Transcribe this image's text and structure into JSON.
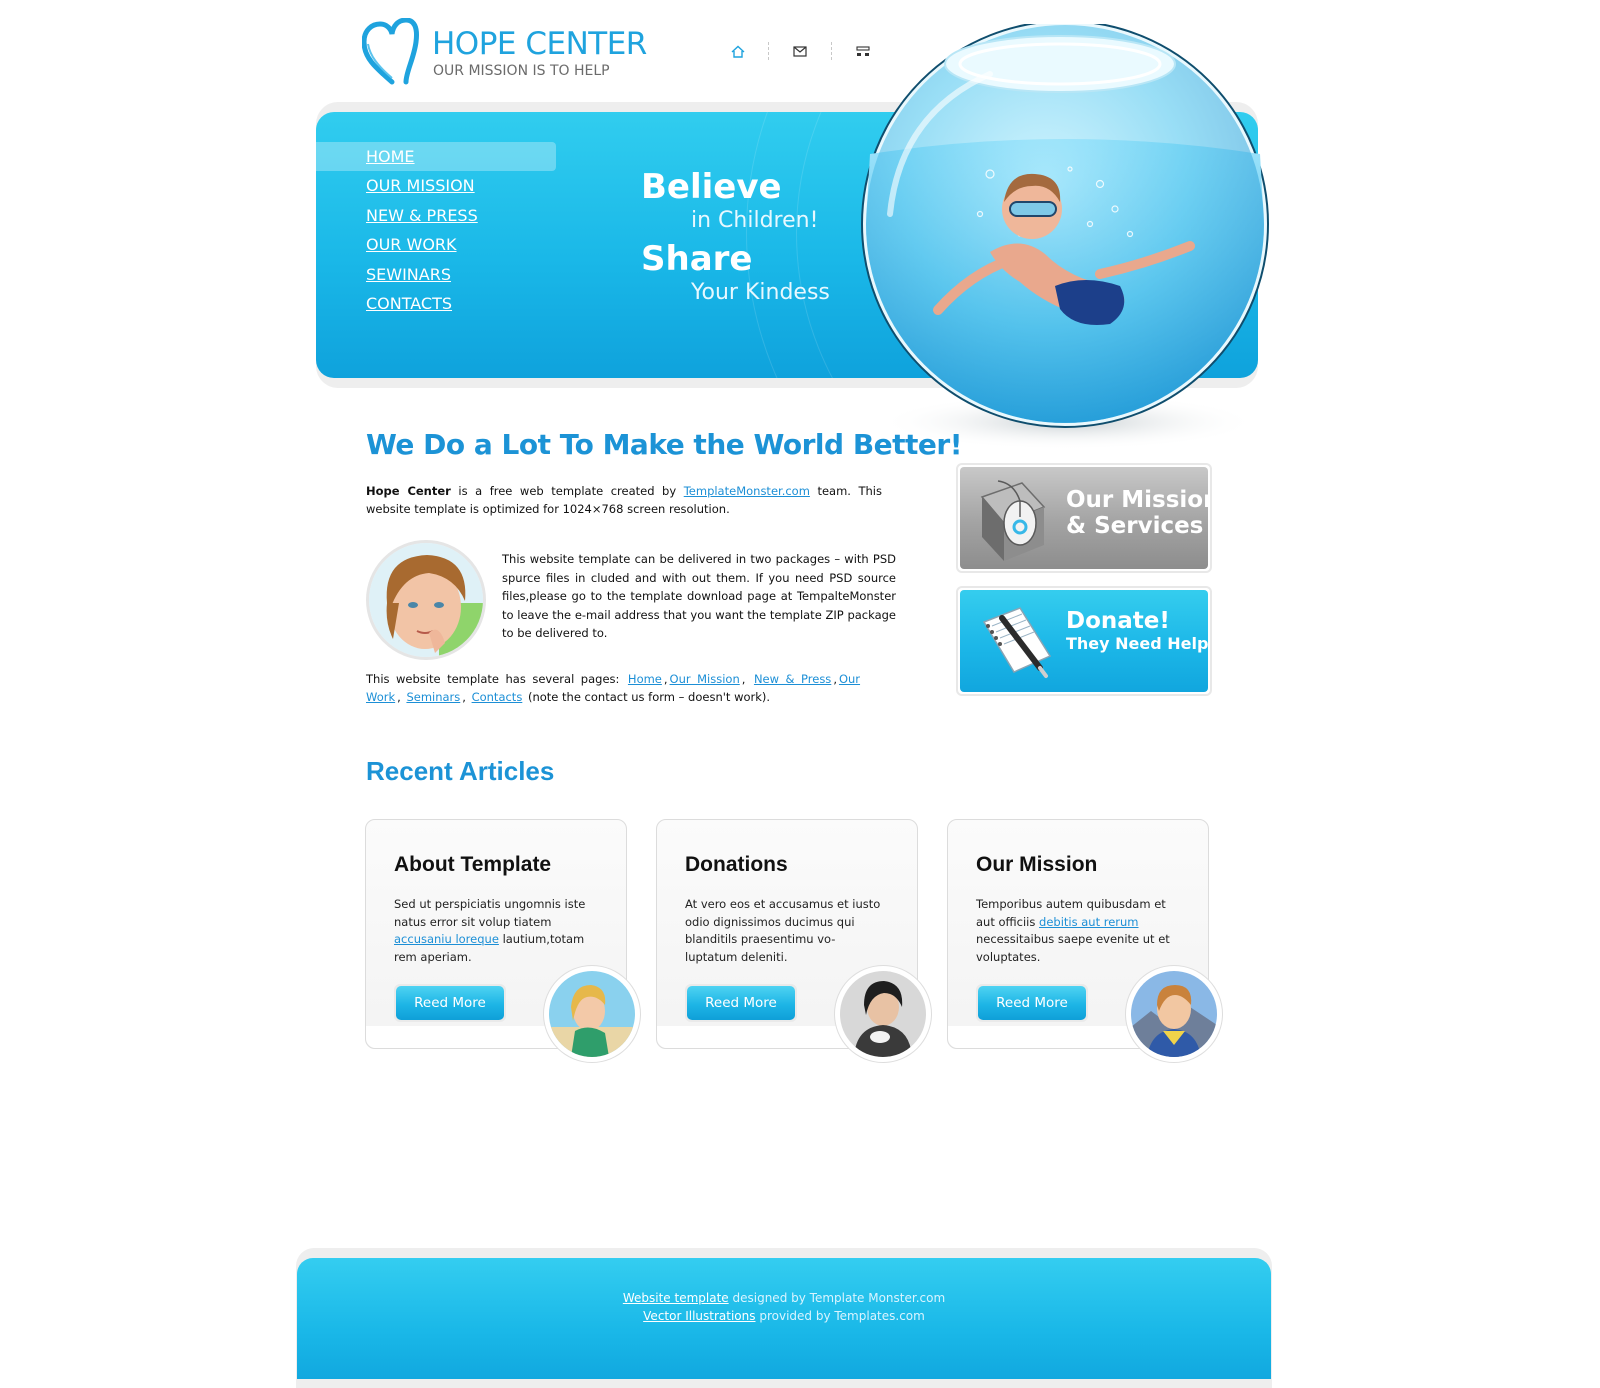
{
  "header": {
    "logo_title": "HOPE CENTER",
    "logo_subtitle": "OUR MISSION IS TO HELP",
    "icons": [
      "home-icon",
      "mail-icon",
      "sitemap-icon"
    ]
  },
  "nav": {
    "items": [
      {
        "label": "HOME",
        "active": true
      },
      {
        "label": "OUR MISSION",
        "active": false
      },
      {
        "label": "NEW & PRESS",
        "active": false
      },
      {
        "label": "OUR WORK",
        "active": false
      },
      {
        "label": "SEWINARS",
        "active": false
      },
      {
        "label": "CONTACTS",
        "active": false
      }
    ]
  },
  "banner": {
    "line1": "Believe",
    "line2": "in Children!",
    "line3": "Share",
    "line4": "Your Kindess"
  },
  "main": {
    "headline": "We Do a Lot To Make the World Better!",
    "intro_brand": "Hope Center",
    "intro_text1": "is a free web template created by",
    "intro_link": "TemplateMonster.com",
    "intro_text2": "team. This website template is optimized for 1024×768 screen resolution.",
    "para2": "This website template can be delivered in two packages – with PSD spurce files in cluded and with out them. If you need PSD source files,please go to the template download page at TempalteMonster to leave the e-mail address that you want the template ZIP package to be delivered to.",
    "pages_text": "This website template has several pages:",
    "pages_links": [
      "Home",
      "Our Mission",
      "New & Press",
      "Our Work",
      "Seminars",
      "Contacts"
    ],
    "pages_note": "(note the contact us form – doesn't work)."
  },
  "promos": {
    "missions": {
      "line1": "Our Missions",
      "line2": "& Services",
      "color": "#a3a3a3"
    },
    "donate": {
      "line1": "Donate!",
      "line2": "They Need Help",
      "color": "#1cb7e8"
    }
  },
  "recent": {
    "title": "Recent Articles",
    "button_label": "Reed More",
    "cards": [
      {
        "title": "About Template",
        "text1": "Sed ut perspiciatis ungomnis iste natus error sit volup tiatem",
        "link": "accusaniu loreque",
        "text2": "lautium,totam rem aperiam."
      },
      {
        "title": "Donations",
        "text1": "At vero eos et accusamus et iusto odio dignissimos ducimus qui blanditils praesentimu vo-luptatum deleniti.",
        "link": "",
        "text2": ""
      },
      {
        "title": "Our Mission",
        "text1": "Temporibus autem quibusdam et aut officiis",
        "link": "debitis aut rerum",
        "text2": "necessitaibus saepe evenite ut et voluptates."
      }
    ]
  },
  "footer": {
    "line1_link": "Website template",
    "line1_text": "designed by Template Monster.com",
    "line2_link": "Vector Illustrations",
    "line2_text": "provided by Templates.com"
  },
  "colors": {
    "accent": "#1fa3de",
    "heading": "#1c93d6",
    "banner": "#1ab8e8"
  }
}
